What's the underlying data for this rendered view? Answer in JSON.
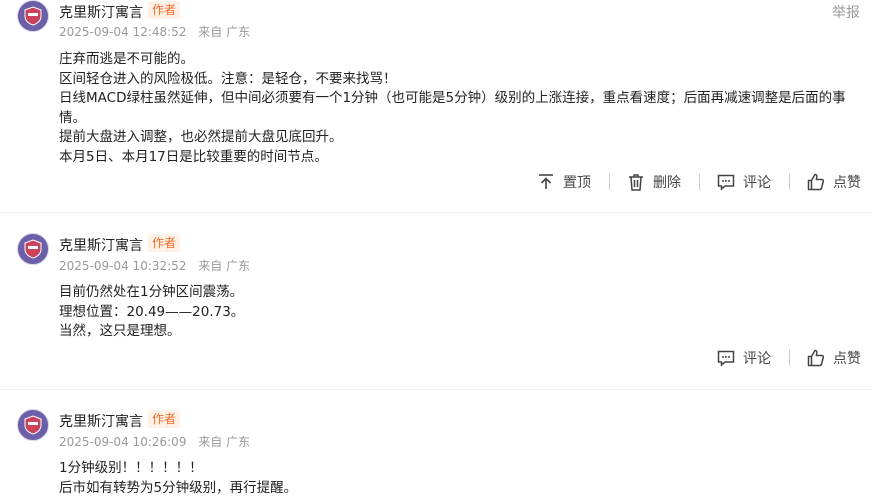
{
  "header": {
    "report_label": "举报"
  },
  "posts": [
    {
      "author": "克里斯汀寓言",
      "badge": "作者",
      "time": "2025-09-04 12:48:52",
      "location": "来自 广东",
      "lines": [
        "庄弃而逃是不可能的。",
        "区间轻仓进入的风险极低。注意：是轻仓，不要来找骂！",
        "日线MACD绿柱虽然延伸，但中间必须要有一个1分钟（也可能是5分钟）级别的上涨连接，重点看速度；后面再减速调整是后面的事情。",
        "提前大盘进入调整，也必然提前大盘见底回升。",
        "本月5日、本月17日是比较重要的时间节点。"
      ],
      "actions": {
        "pin": "置顶",
        "delete": "删除",
        "comment": "评论",
        "like": "点赞"
      }
    },
    {
      "author": "克里斯汀寓言",
      "badge": "作者",
      "time": "2025-09-04 10:32:52",
      "location": "来自 广东",
      "lines": [
        "目前仍然处在1分钟区间震荡。",
        "理想位置：20.49——20.73。",
        "当然，这只是理想。"
      ],
      "actions": {
        "comment": "评论",
        "like": "点赞"
      }
    },
    {
      "author": "克里斯汀寓言",
      "badge": "作者",
      "time": "2025-09-04 10:26:09",
      "location": "来自 广东",
      "lines": [
        "1分钟级别！！！！！！",
        "后市如有转势为5分钟级别，再行提醒。"
      ]
    }
  ]
}
